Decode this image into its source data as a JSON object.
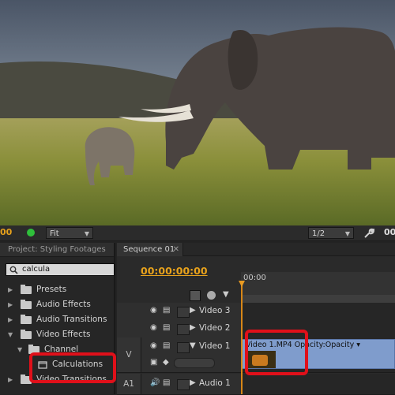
{
  "monitor": {
    "timecode_left": "00",
    "zoom": "Fit",
    "resolution": "1/2",
    "timecode_right": "00"
  },
  "project": {
    "tab_label": "Project: Styling Footages",
    "search_value": "calcula",
    "tree": [
      {
        "label": "Presets"
      },
      {
        "label": "Audio Effects"
      },
      {
        "label": "Audio Transitions"
      },
      {
        "label": "Video Effects"
      },
      {
        "label": "Channel"
      },
      {
        "label": "Calculations"
      },
      {
        "label": "Video Transitions"
      }
    ]
  },
  "timeline": {
    "tab_label": "Sequence 01",
    "timecode": "00:00:00:00",
    "ruler_label": "00:00",
    "tracks": {
      "video3": "Video 3",
      "video2": "Video 2",
      "video1": "Video 1",
      "audio1": "Audio 1"
    },
    "target_video": "V",
    "target_audio": "A1",
    "clip_title": "Video 1.MP4  Opacity:Opacity ▾"
  },
  "colors": {
    "accent_timecode": "#e8a21c",
    "clip": "#7f9ccc",
    "highlight": "#e0101a"
  }
}
